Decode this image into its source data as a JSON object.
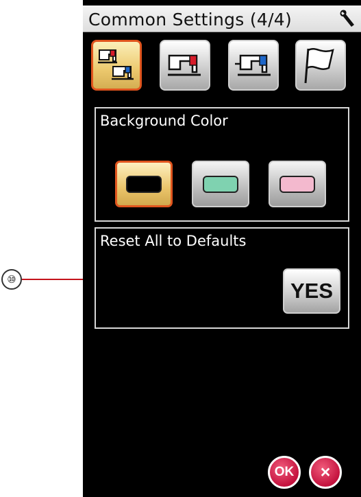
{
  "callout": {
    "number": "⑩"
  },
  "header": {
    "title": "Common Settings (4/4)",
    "icon": "wrench-icon"
  },
  "tabs": [
    {
      "name": "machine-settings-tab",
      "icon": "two-machines-icon",
      "active": true
    },
    {
      "name": "straight-stitch-tab",
      "icon": "machine-red-icon",
      "active": false
    },
    {
      "name": "embroidery-tab",
      "icon": "machine-blue-icon",
      "active": false
    },
    {
      "name": "language-tab",
      "icon": "flag-icon",
      "active": false
    }
  ],
  "background_color": {
    "title": "Background Color",
    "options": [
      {
        "name": "black",
        "color": "#000000",
        "selected": true
      },
      {
        "name": "green",
        "color": "#7fd2b0",
        "selected": false
      },
      {
        "name": "pink",
        "color": "#f3b9ce",
        "selected": false
      }
    ]
  },
  "reset": {
    "title": "Reset All to Defaults",
    "yes_label": "YES"
  },
  "footer": {
    "ok_label": "OK",
    "close_label": "×"
  },
  "colors": {
    "screen": "#000000",
    "active_border": "#e0551e",
    "button_red": "#c4123e",
    "callout_line": "#c4141b"
  }
}
